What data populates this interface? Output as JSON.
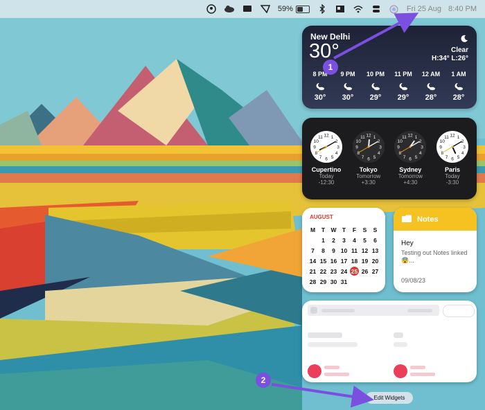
{
  "menubar": {
    "battery_percent": "59%",
    "battery_level": 0.59,
    "date": "Fri 25 Aug",
    "time": "8:40 PM"
  },
  "weather": {
    "city": "New Delhi",
    "temp": "30°",
    "condition": "Clear",
    "high_low": "H:34° L:26°",
    "icon": "moon-icon",
    "hours": [
      {
        "time": "8 PM",
        "temp": "30°"
      },
      {
        "time": "9 PM",
        "temp": "30°"
      },
      {
        "time": "10 PM",
        "temp": "29°"
      },
      {
        "time": "11 PM",
        "temp": "29°"
      },
      {
        "time": "12 AM",
        "temp": "28°"
      },
      {
        "time": "1 AM",
        "temp": "28°"
      }
    ]
  },
  "clocks": [
    {
      "city": "Cupertino",
      "day": "Today",
      "offset": "-12:30",
      "face": "light",
      "h": 8,
      "m": 10
    },
    {
      "city": "Tokyo",
      "day": "Tomorrow",
      "offset": "+3:30",
      "face": "dark",
      "h": 12,
      "m": 10
    },
    {
      "city": "Sydney",
      "day": "Tomorrow",
      "offset": "+4:30",
      "face": "dark",
      "h": 1,
      "m": 10
    },
    {
      "city": "Paris",
      "day": "Today",
      "offset": "-3:30",
      "face": "light",
      "h": 5,
      "m": 10
    }
  ],
  "calendar": {
    "month": "AUGUST",
    "weekdays": [
      "M",
      "T",
      "W",
      "T",
      "F",
      "S",
      "S"
    ],
    "weeks": [
      [
        "",
        "1",
        "2",
        "3",
        "4",
        "5",
        "6"
      ],
      [
        "7",
        "8",
        "9",
        "10",
        "11",
        "12",
        "13"
      ],
      [
        "14",
        "15",
        "16",
        "17",
        "18",
        "19",
        "20"
      ],
      [
        "21",
        "22",
        "23",
        "24",
        "25",
        "26",
        "27"
      ],
      [
        "28",
        "29",
        "30",
        "31",
        "",
        "",
        ""
      ]
    ],
    "today": "25",
    "accent_color": "#e0382f"
  },
  "notes": {
    "header": "Notes",
    "title": "Hey",
    "body": "Testing out Notes linked 😨...",
    "date": "09/08/23",
    "accent_color": "#f5c221"
  },
  "edit_widgets": "Edit Widgets",
  "annotations": {
    "badge_1": "1",
    "badge_2": "2",
    "color": "#7b4fe0"
  }
}
